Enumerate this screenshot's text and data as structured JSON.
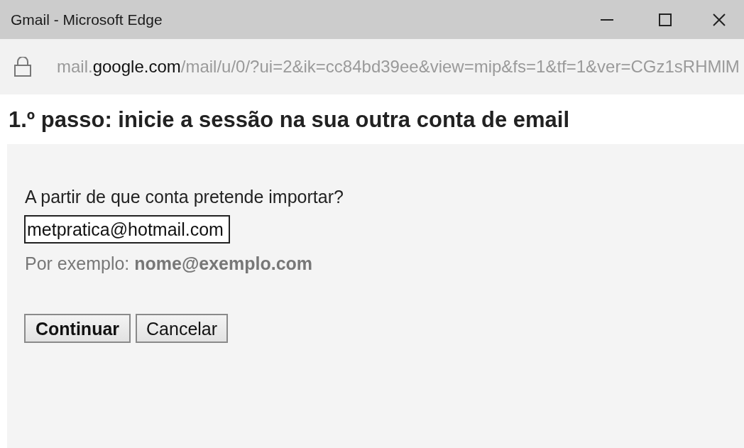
{
  "window": {
    "title": "Gmail - Microsoft Edge"
  },
  "address_bar": {
    "segments": [
      {
        "text": "mail.",
        "highlighted": false
      },
      {
        "text": "google.com",
        "highlighted": true
      },
      {
        "text": "/mail/u/0/?ui=2&ik=cc84bd39ee&view=mip&fs=1&tf=1&ver=CGz1sRHMlM",
        "highlighted": false
      }
    ]
  },
  "heading": "1.º passo: inicie a sessão na sua outra conta de email",
  "form": {
    "label": "A partir de que conta pretende importar?",
    "email_field": {
      "value": "metpratica@hotmail.com"
    },
    "hint": "Por exemplo: **nome@exemplo.com**",
    "buttons": [
      {
        "label": "Continuar",
        "primary": true
      },
      {
        "label": "Cancelar",
        "primary": false
      }
    ]
  }
}
